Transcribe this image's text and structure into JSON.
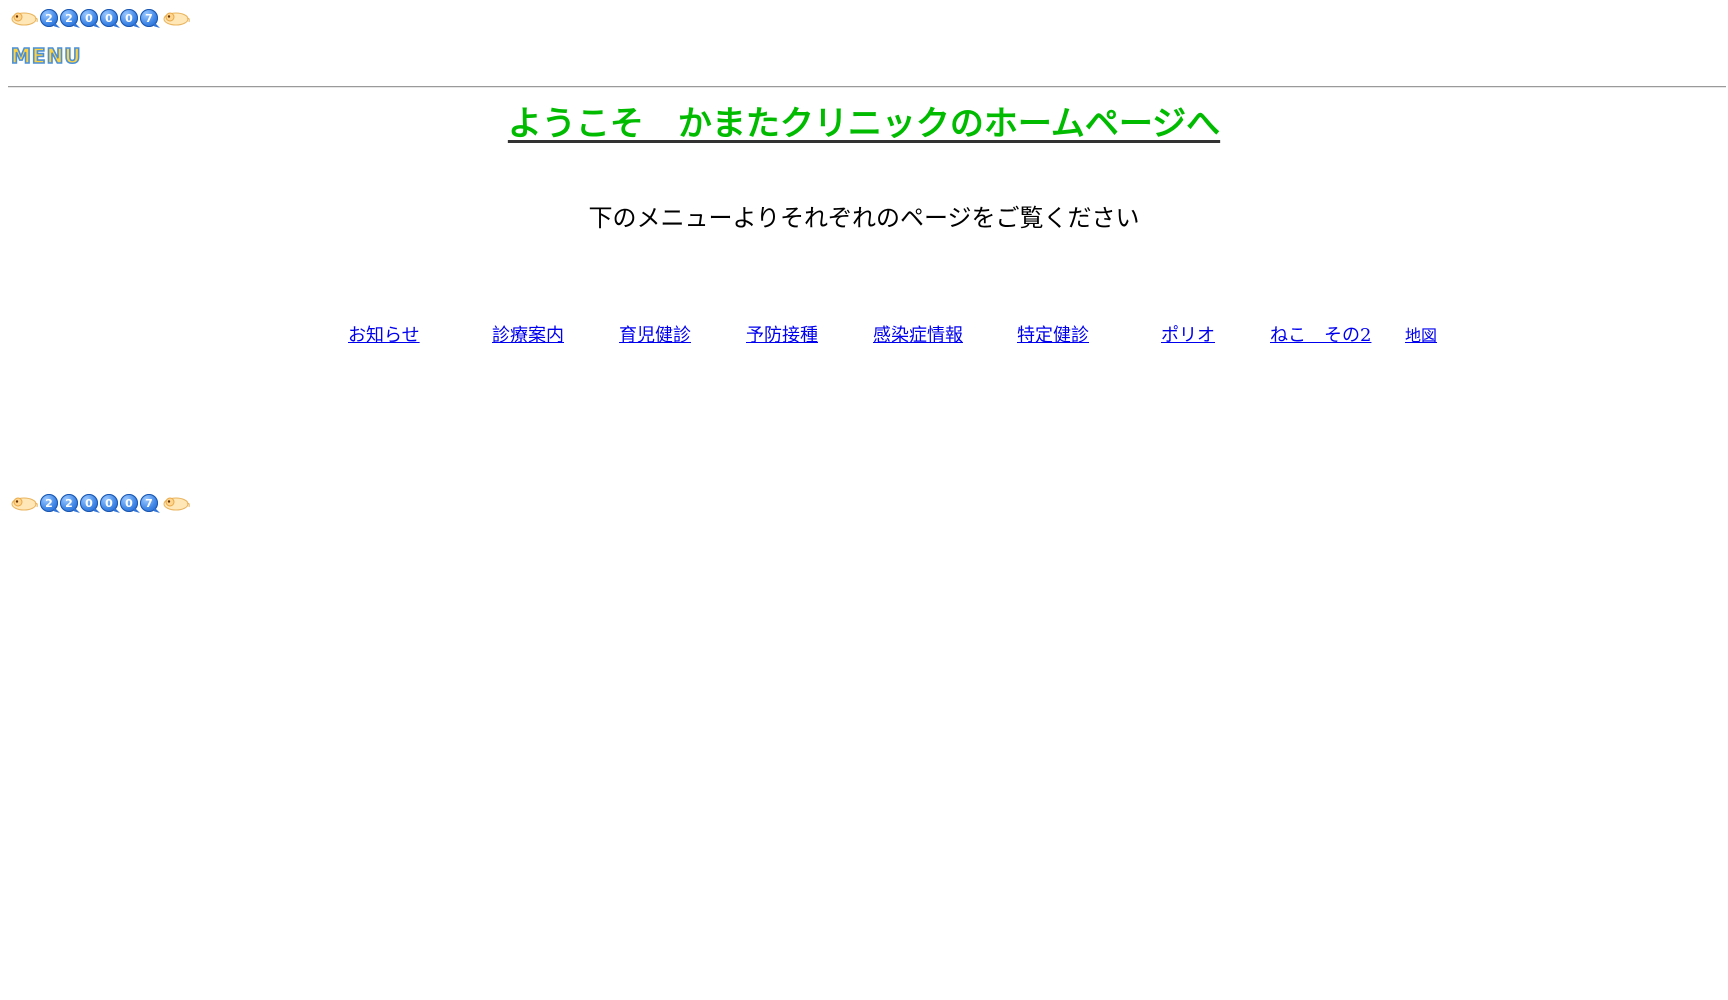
{
  "counter": {
    "digits": [
      "2",
      "2",
      "0",
      "0",
      "0",
      "7"
    ]
  },
  "menu_logo": {
    "text": "MENU"
  },
  "heading": {
    "title": "ようこそ　かまたクリニックのホームページへ",
    "subtitle": "下のメニューよりそれぞれのページをご覧ください"
  },
  "nav": {
    "items": [
      {
        "label": "お知らせ"
      },
      {
        "label": "診療案内"
      },
      {
        "label": "育児健診"
      },
      {
        "label": "予防接種"
      },
      {
        "label": "感染症情報"
      },
      {
        "label": "特定健診"
      },
      {
        "label": "ポリオ"
      },
      {
        "label": "ねこ　その2"
      },
      {
        "label": "地図"
      }
    ]
  },
  "colors": {
    "title": "#00bb00",
    "link": "#0000ee",
    "counter_digit": "#3f86e6"
  }
}
